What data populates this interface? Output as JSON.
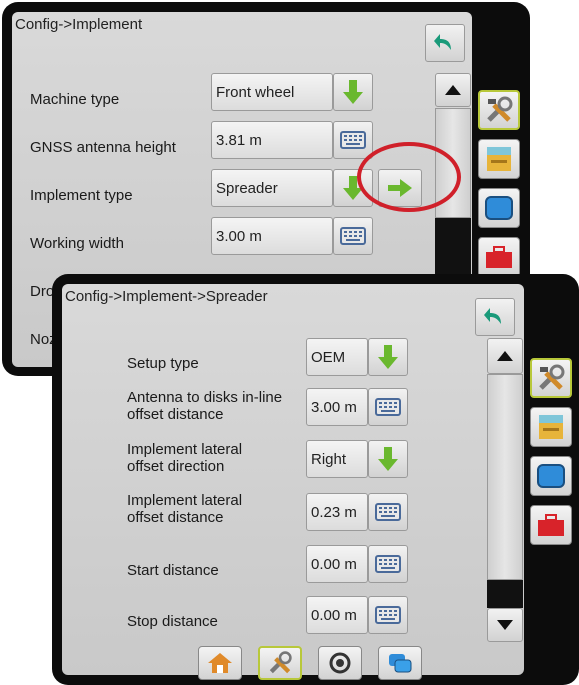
{
  "back_screen": {
    "title": "Config->Implement",
    "rows": [
      {
        "label": "Machine type",
        "value": "Front wheel"
      },
      {
        "label": "GNSS antenna height",
        "value": "3.81 m"
      },
      {
        "label": "Implement type",
        "value": "Spreader"
      },
      {
        "label": "Working width",
        "value": "3.00 m"
      },
      {
        "label": "Dro",
        "value": ""
      },
      {
        "label": "Noz",
        "value": ""
      }
    ]
  },
  "front_screen": {
    "title": "Config->Implement->Spreader",
    "rows": [
      {
        "label": "Setup type",
        "value": "OEM"
      },
      {
        "label": "Antenna to disks in-line offset distance",
        "value": "3.00 m"
      },
      {
        "label": "Implement lateral offset direction",
        "value": "Right"
      },
      {
        "label": "Implement lateral offset distance",
        "value": "0.23 m"
      },
      {
        "label": "Start distance",
        "value": "0.00 m"
      },
      {
        "label": "Stop distance",
        "value": "0.00 m"
      }
    ]
  },
  "colors": {
    "green_arrow": "#6ab82e",
    "back_arrow": "#1a9a7a",
    "highlight_circle": "#d0202a",
    "active_tab_border": "#b8c83a"
  },
  "icons": {
    "side_tabs": [
      "tools-icon",
      "console-icon",
      "screen-icon",
      "toolbox-icon"
    ],
    "bottom_tabs": [
      "home-icon",
      "tools-icon",
      "gauge-icon",
      "screens-icon"
    ]
  }
}
